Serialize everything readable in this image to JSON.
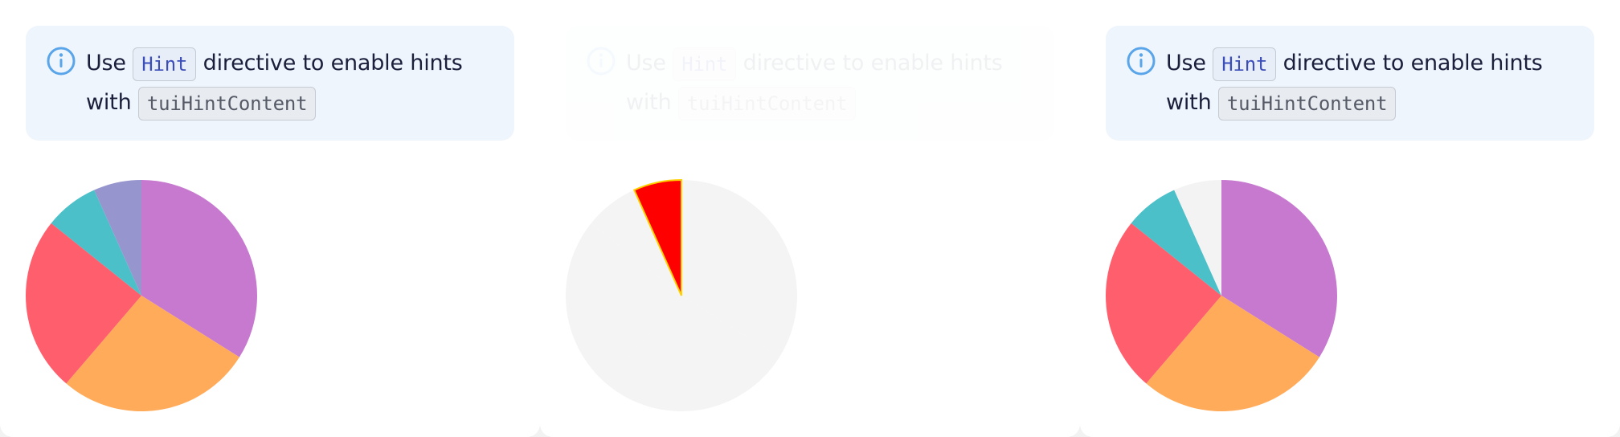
{
  "notice": {
    "use": "Use",
    "code_hint": "Hint",
    "after": "directive to enable hints with",
    "code_content": "tuiHintContent"
  },
  "colors": {
    "slice_palette": [
      "#c779d0",
      "#ffab5a",
      "#ff5f6d",
      "#4bc0c8",
      "#9795cd"
    ],
    "dimmed_slice": "#f4f4f4",
    "highlight": "#ff0000",
    "info_icon": "#5aa5ea"
  },
  "chart_data": [
    {
      "type": "pie",
      "state": "default",
      "values": [
        36,
        29,
        26,
        8,
        7.1
      ]
    },
    {
      "type": "pie",
      "state": "hovered",
      "values": [
        36,
        29,
        26,
        8,
        7.1
      ],
      "hovered_index": 4
    },
    {
      "type": "pie",
      "state": "slice-hidden",
      "values": [
        36,
        29,
        26,
        8,
        7.1
      ],
      "hidden_index": 4
    }
  ]
}
